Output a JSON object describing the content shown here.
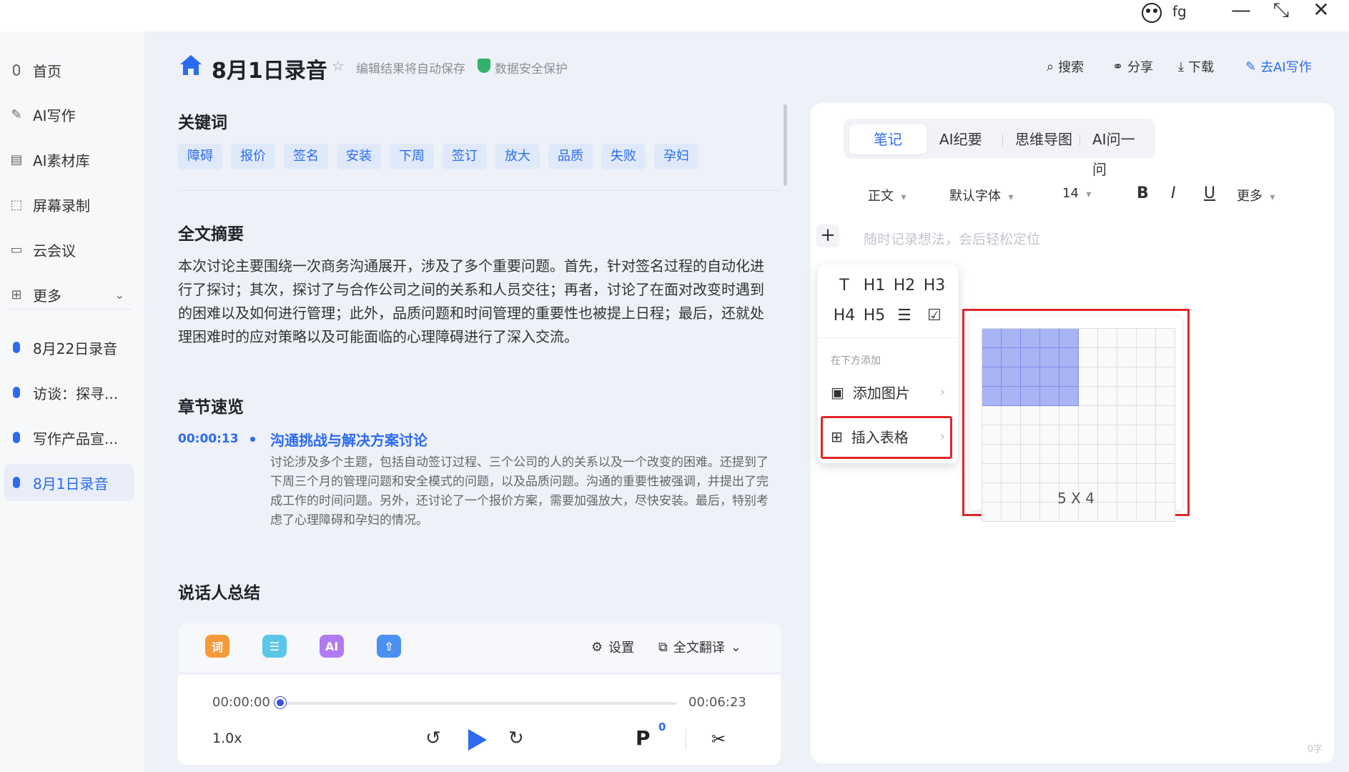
{
  "titlebar": {
    "user": "fg",
    "minimize": "—",
    "restore": "⤡",
    "close": "✕"
  },
  "sidebar": {
    "items": [
      {
        "label": "首页",
        "icon": "mic-outline-icon"
      },
      {
        "label": "AI写作",
        "icon": "write-icon"
      },
      {
        "label": "AI素材库",
        "icon": "library-icon"
      },
      {
        "label": "屏幕录制",
        "icon": "screen-record-icon"
      },
      {
        "label": "云会议",
        "icon": "video-icon"
      },
      {
        "label": "更多",
        "icon": "grid-icon"
      }
    ],
    "recordings": [
      {
        "label": "8月22日录音"
      },
      {
        "label": "访谈：探寻..."
      },
      {
        "label": "写作产品宣..."
      },
      {
        "label": "8月1日录音",
        "active": true
      }
    ]
  },
  "header": {
    "title": "8月1日录音",
    "autosave": "编辑结果将自动保存",
    "security": "数据安全保护",
    "search": "搜索",
    "share": "分享",
    "download": "下载",
    "ai_write": "去AI写作"
  },
  "content": {
    "keywords_title": "关键词",
    "keywords": [
      "障碍",
      "报价",
      "签名",
      "安装",
      "下周",
      "签订",
      "放大",
      "品质",
      "失败",
      "孕妇"
    ],
    "summary_title": "全文摘要",
    "summary": "本次讨论主要围绕一次商务沟通展开，涉及了多个重要问题。首先，针对签名过程的自动化进行了探讨；其次，探讨了与合作公司之间的关系和人员交往；再者，讨论了在面对改变时遇到的困难以及如何进行管理；此外，品质问题和时间管理的重要性也被提上日程；最后，还就处理困难时的应对策略以及可能面临的心理障碍进行了深入交流。",
    "chapters_title": "章节速览",
    "chapter": {
      "time": "00:00:13",
      "title": "沟通挑战与解决方案讨论",
      "text": "讨论涉及多个主题，包括自动签订过程、三个公司的人的关系以及一个改变的困难。还提到了下周三个月的管理问题和安全模式的问题，以及品质问题。沟通的重要性被强调，并提出了完成工作的时间问题。另外，还讨论了一个报价方案，需要加强放大，尽快安装。最后，特别考虑了心理障碍和孕妇的情况。"
    },
    "speakers_title": "说话人总结"
  },
  "player": {
    "tools": [
      {
        "label": "词",
        "color": "#f59a3c"
      },
      {
        "label": "☰",
        "color": "#5cc6e8"
      },
      {
        "label": "AI",
        "color": "#b27af0"
      },
      {
        "label": "⇧",
        "color": "#4a90f0"
      }
    ],
    "settings": "设置",
    "translate": "全文翻译",
    "current_time": "00:00:00",
    "total_time": "00:06:23",
    "progress": 0,
    "speed": "1.0x",
    "marks": "0"
  },
  "right": {
    "tabs": [
      "笔记",
      "AI纪要",
      "思维导图",
      "AI问一问"
    ],
    "active_tab": "笔记",
    "format": {
      "style": "正文",
      "font": "默认字体",
      "size": "14",
      "bold": "B",
      "italic": "I",
      "underline": "U",
      "more": "更多"
    },
    "placeholder": "随时记录想法，会后轻松定位",
    "menu": {
      "headings": [
        "T",
        "H1",
        "H2",
        "H3",
        "H4",
        "H5",
        "☰",
        "☑"
      ],
      "add_below": "在下方添加",
      "add_image": "添加图片",
      "insert_table": "插入表格"
    },
    "table_picker": {
      "rows": 10,
      "cols": 10,
      "selected_cols": 5,
      "selected_rows": 4,
      "size_label": "5 X 4"
    },
    "word_count": "0字"
  },
  "colors": {
    "accent": "#2c6bf0",
    "highlight": "#e0262a",
    "selection": "#a9b4f5"
  }
}
